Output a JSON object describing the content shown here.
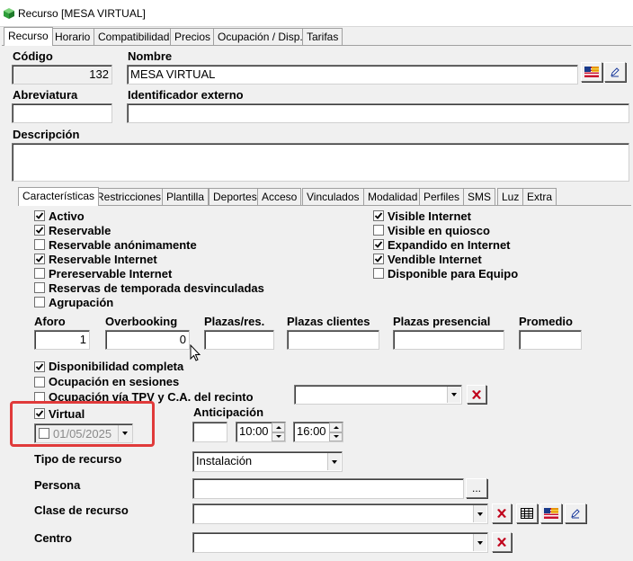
{
  "window": {
    "title": "Recurso [MESA VIRTUAL]"
  },
  "main_tabs": [
    {
      "label": "Recurso"
    },
    {
      "label": "Horario"
    },
    {
      "label": "Compatibilidad"
    },
    {
      "label": "Precios"
    },
    {
      "label": "Ocupación / Disp."
    },
    {
      "label": "Tarifas"
    }
  ],
  "header": {
    "codigo_label": "Código",
    "codigo_value": "132",
    "nombre_label": "Nombre",
    "nombre_value": "MESA VIRTUAL",
    "abreviatura_label": "Abreviatura",
    "abreviatura_value": "",
    "identificador_label": "Identificador externo",
    "identificador_value": "",
    "descripcion_label": "Descripción",
    "descripcion_value": ""
  },
  "sub_tabs": [
    {
      "label": "Características"
    },
    {
      "label": "Restricciones"
    },
    {
      "label": "Plantilla"
    },
    {
      "label": "Deportes"
    },
    {
      "label": "Acceso"
    },
    {
      "label": "Vinculados"
    },
    {
      "label": "Modalidad"
    },
    {
      "label": "Perfiles"
    },
    {
      "label": "SMS"
    },
    {
      "label": "Luz"
    },
    {
      "label": "Extra"
    }
  ],
  "checkboxes_left": [
    {
      "label": "Activo",
      "checked": true
    },
    {
      "label": "Reservable",
      "checked": true
    },
    {
      "label": "Reservable anónimamente",
      "checked": false
    },
    {
      "label": "Reservable Internet",
      "checked": true
    },
    {
      "label": "Prereservable Internet",
      "checked": false
    },
    {
      "label": "Reservas de temporada desvinculadas",
      "checked": false
    },
    {
      "label": "Agrupación",
      "checked": false
    }
  ],
  "checkboxes_right": [
    {
      "label": "Visible Internet",
      "checked": true
    },
    {
      "label": "Visible en quiosco",
      "checked": false
    },
    {
      "label": "Expandido en Internet",
      "checked": true
    },
    {
      "label": "Vendible Internet",
      "checked": true
    },
    {
      "label": "Disponible para Equipo",
      "checked": false
    }
  ],
  "capacity": {
    "aforo_label": "Aforo",
    "aforo_value": "1",
    "overbooking_label": "Overbooking",
    "overbooking_value": "0",
    "plazas_res_label": "Plazas/res.",
    "plazas_res_value": "",
    "plazas_clientes_label": "Plazas clientes",
    "plazas_clientes_value": "",
    "plazas_presencial_label": "Plazas presencial",
    "plazas_presencial_value": "",
    "promedio_label": "Promedio",
    "promedio_value": ""
  },
  "availability": [
    {
      "label": "Disponibilidad completa",
      "checked": true
    },
    {
      "label": "Ocupación en sesiones",
      "checked": false
    },
    {
      "label": "Ocupación vía TPV y C.A. del recinto",
      "checked": false
    }
  ],
  "virtual": {
    "label": "Virtual",
    "checked": true,
    "date_checked": false,
    "date_value": "01/05/2025"
  },
  "anticipacion": {
    "label": "Anticipación",
    "value": "",
    "time_from": "10:00",
    "time_to": "16:00"
  },
  "form": {
    "tipo_label": "Tipo de recurso",
    "tipo_value": "Instalación",
    "persona_label": "Persona",
    "persona_value": "",
    "persona_button": "...",
    "clase_label": "Clase de recurso",
    "clase_value": "",
    "centro_label": "Centro",
    "centro_value": ""
  },
  "colors": {
    "highlight": "#e03a3a",
    "delete_icon": "#c0001a",
    "app_icon": "#2e9e3a"
  }
}
